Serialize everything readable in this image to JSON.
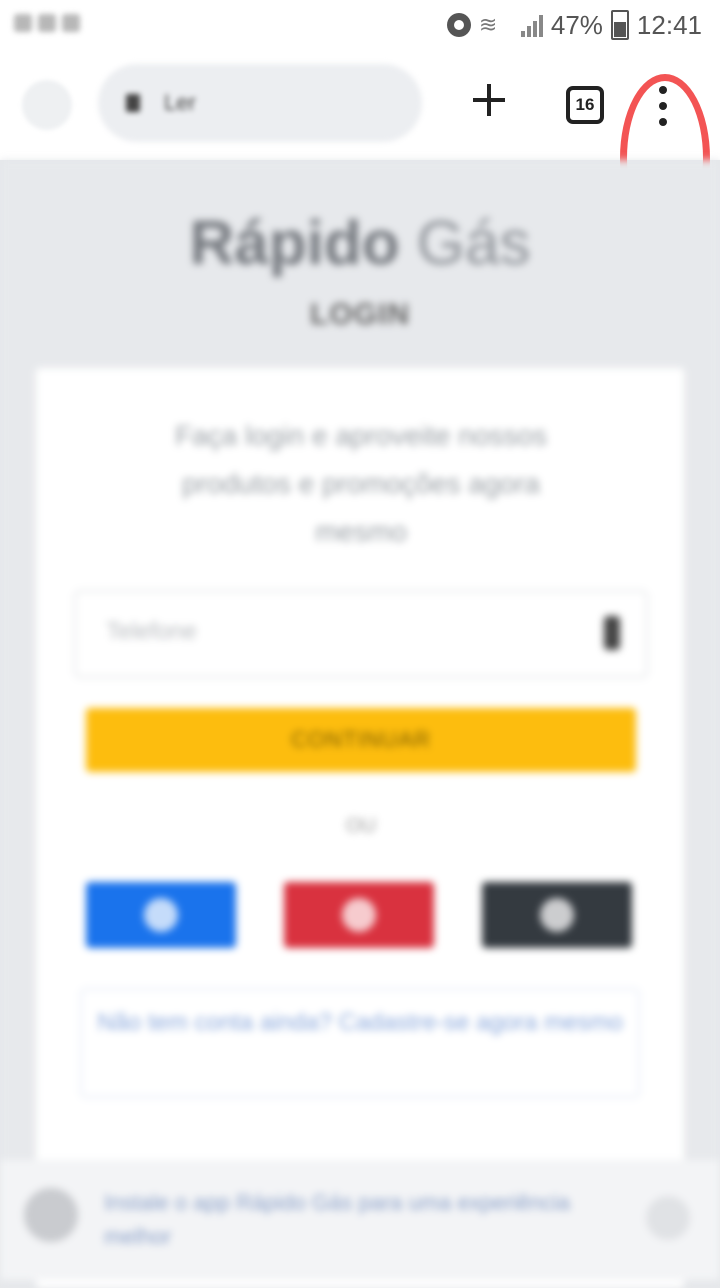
{
  "status": {
    "battery": "47%",
    "time": "12:41"
  },
  "browser": {
    "url": "Ler",
    "tab_count": "16"
  },
  "page": {
    "brand_bold": "Rápido",
    "brand_light": " Gás",
    "subtitle": "LOGIN",
    "description": "Faça login e aproveite nossos produtos e promoções agora mesmo",
    "phone_placeholder": "Telefone",
    "continue_label": "CONTINUAR",
    "or_label": "OU",
    "signup_text": "Não tem conta ainda? Cadastre-se agora mesmo",
    "banner_text": "Instale o app Rápido Gás para uma experiência melhor"
  },
  "colors": {
    "highlight": "#f35454",
    "continue": "#fdbd0e",
    "facebook": "#1a73ec",
    "google": "#d9323f",
    "apple": "#343a40"
  }
}
